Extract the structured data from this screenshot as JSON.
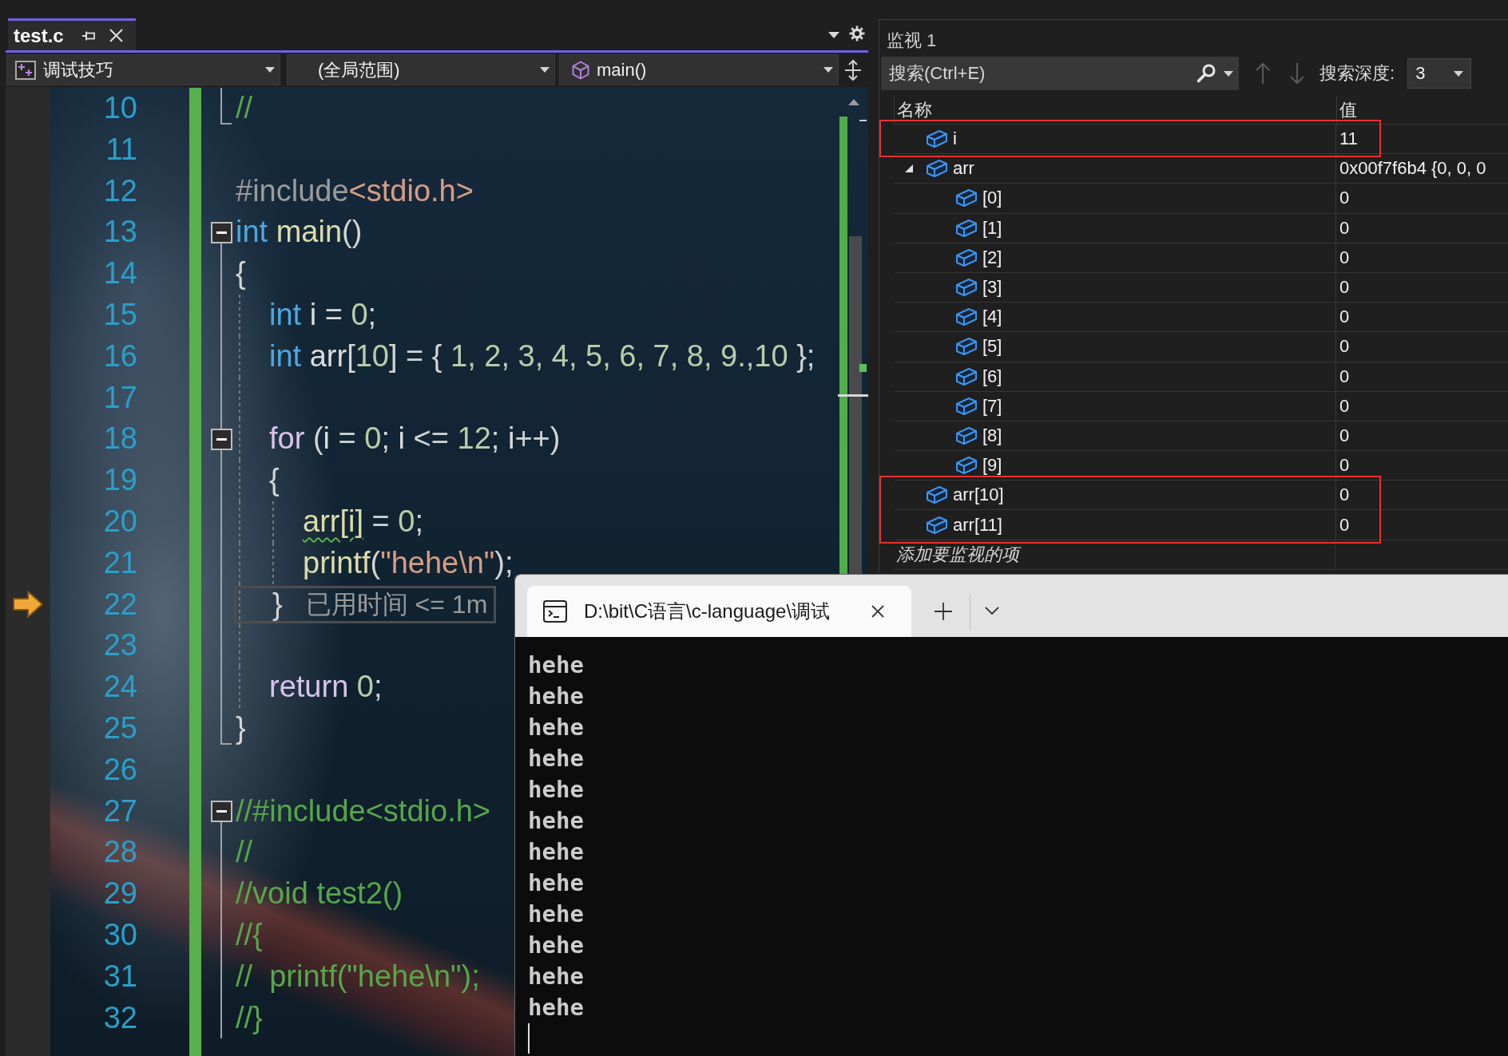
{
  "editor_tabs": [
    {
      "label": "test.c",
      "selected": true
    }
  ],
  "nav_bar": [
    {
      "kind": "project",
      "text": "调试技巧"
    },
    {
      "kind": "scope",
      "text": "(全局范围)"
    },
    {
      "kind": "member",
      "text": "main()"
    }
  ],
  "code_lines": [
    {
      "number": "10",
      "kind": "closer",
      "current": false,
      "tokens": [
        {
          "kind": "comment",
          "text": "//"
        }
      ]
    },
    {
      "number": "11",
      "kind": "plain",
      "current": false
    },
    {
      "number": "12",
      "kind": "plain",
      "current": false,
      "tokens": [
        {
          "kind": "preproc",
          "text": "#include"
        },
        {
          "kind": "string",
          "text": "<stdio.h>"
        }
      ]
    },
    {
      "number": "13",
      "kind": "opener",
      "current": false,
      "tokens": [
        {
          "kind": "keyword",
          "text": "int"
        },
        {
          "kind": "func",
          "text": " main"
        },
        {
          "kind": "punct",
          "text": "()"
        }
      ]
    },
    {
      "number": "14",
      "kind": "inner",
      "current": false,
      "tokens": [
        {
          "kind": "punct",
          "text": "{"
        }
      ],
      "children": [
        {
          "number": "15",
          "kind": "inner",
          "current": false,
          "tokens": [
            {
              "kind": "keyword",
              "text": "int"
            },
            {
              "kind": "ident",
              "text": " i = "
            },
            {
              "kind": "number",
              "text": "0"
            },
            {
              "kind": "punct",
              "text": ";"
            }
          ]
        },
        {
          "number": "16",
          "kind": "inner",
          "current": false,
          "tokens": [
            {
              "kind": "keyword",
              "text": "int"
            },
            {
              "kind": "ident",
              "text": " arr"
            },
            {
              "kind": "punct",
              "text": "["
            },
            {
              "kind": "number",
              "text": "10"
            },
            {
              "kind": "punct",
              "text": "] = { "
            },
            {
              "kind": "number",
              "text": "1, 2, 3, 4, 5, 6, 7, 8, 9.,10"
            },
            {
              "kind": "punct",
              "text": " };"
            }
          ]
        },
        {
          "number": "17",
          "kind": "inner",
          "current": false
        },
        {
          "number": "18",
          "kind": "opener",
          "current": false,
          "tokens": [
            {
              "kind": "control",
              "text": "for"
            },
            {
              "kind": "punct",
              "text": " ("
            },
            {
              "kind": "ident",
              "text": "i"
            },
            {
              "kind": "punct",
              "text": " = "
            },
            {
              "kind": "number",
              "text": "0"
            },
            {
              "kind": "punct",
              "text": "; "
            },
            {
              "kind": "ident",
              "text": "i"
            },
            {
              "kind": "punct",
              "text": " <= "
            },
            {
              "kind": "number",
              "text": "12"
            },
            {
              "kind": "punct",
              "text": "; "
            },
            {
              "kind": "ident",
              "text": "i"
            },
            {
              "kind": "punct",
              "text": "++)"
            }
          ]
        },
        {
          "number": "19",
          "kind": "inner",
          "current": false,
          "tokens": [
            {
              "kind": "punct",
              "text": "{"
            }
          ],
          "children": [
            {
              "number": "20",
              "kind": "inner",
              "current": false,
              "tokens": [
                {
                  "kind": "warning",
                  "text": "arr[i]"
                },
                {
                  "kind": "punct",
                  "text": " = "
                },
                {
                  "kind": "number",
                  "text": "0"
                },
                {
                  "kind": "punct",
                  "text": ";"
                }
              ]
            },
            {
              "number": "21",
              "kind": "inner",
              "current": false,
              "tokens": [
                {
                  "kind": "func",
                  "text": "printf"
                },
                {
                  "kind": "punct",
                  "text": "("
                },
                {
                  "kind": "string",
                  "text": "\"hehe\\n\""
                },
                {
                  "kind": "punct",
                  "text": ");"
                }
              ]
            }
          ]
        },
        {
          "number": "22",
          "kind": "inner",
          "current": true,
          "tokens": [
            {
              "kind": "punct",
              "text": "}"
            }
          ],
          "perf_tip": "已用时间 <= 1m"
        },
        {
          "number": "23",
          "kind": "inner",
          "current": false
        },
        {
          "number": "24",
          "kind": "inner",
          "current": false,
          "tokens": [
            {
              "kind": "control",
              "text": "return"
            },
            {
              "kind": "number",
              "text": " 0"
            },
            {
              "kind": "punct",
              "text": ";"
            }
          ]
        }
      ]
    },
    {
      "number": "25",
      "kind": "closer",
      "current": false,
      "tokens": [
        {
          "kind": "punct",
          "text": "}"
        }
      ]
    },
    {
      "number": "26",
      "kind": "plain",
      "current": false
    },
    {
      "number": "27",
      "kind": "opener",
      "current": false,
      "tokens": [
        {
          "kind": "comment",
          "text": "//#include<stdio.h>"
        }
      ]
    },
    {
      "number": "28",
      "kind": "inner",
      "current": false,
      "tokens": [
        {
          "kind": "comment",
          "text": "//"
        }
      ]
    },
    {
      "number": "29",
      "kind": "inner",
      "current": false,
      "tokens": [
        {
          "kind": "comment",
          "text": "//void test2()"
        }
      ]
    },
    {
      "number": "30",
      "kind": "inner",
      "current": false,
      "tokens": [
        {
          "kind": "comment",
          "text": "//{"
        }
      ]
    },
    {
      "number": "31",
      "kind": "inner",
      "current": false,
      "tokens": [
        {
          "kind": "comment",
          "text": "//  printf(\"hehe\\n\");"
        }
      ]
    },
    {
      "number": "32",
      "kind": "inner",
      "current": false,
      "tokens": [
        {
          "kind": "comment",
          "text": "//}"
        }
      ]
    }
  ],
  "watch": {
    "title": "监视 1",
    "search": {
      "placeholder": "搜索(Ctrl+E)"
    },
    "search_nav": [
      {
        "kind": "up",
        "disabled": true
      },
      {
        "kind": "down",
        "disabled": true
      }
    ],
    "depth": {
      "label": "搜索深度:",
      "value": "3"
    },
    "columns": [
      "名称",
      "值"
    ],
    "rows": [
      {
        "name": "i",
        "value": "11",
        "highlighted": true
      },
      {
        "name": "arr",
        "value": "0x00f7f6b4 {0, 0, 0",
        "expanded": true,
        "highlighted": false,
        "children": [
          {
            "name": "[0]",
            "value": "0",
            "highlighted": false
          },
          {
            "name": "[1]",
            "value": "0",
            "highlighted": false
          },
          {
            "name": "[2]",
            "value": "0",
            "highlighted": false
          },
          {
            "name": "[3]",
            "value": "0",
            "highlighted": false
          },
          {
            "name": "[4]",
            "value": "0",
            "highlighted": false
          },
          {
            "name": "[5]",
            "value": "0",
            "highlighted": false
          },
          {
            "name": "[6]",
            "value": "0",
            "highlighted": false
          },
          {
            "name": "[7]",
            "value": "0",
            "highlighted": false
          },
          {
            "name": "[8]",
            "value": "0",
            "highlighted": false
          },
          {
            "name": "[9]",
            "value": "0",
            "highlighted": false
          }
        ]
      },
      {
        "name": "arr[10]",
        "value": "0",
        "highlighted": true
      },
      {
        "name": "arr[11]",
        "value": "0",
        "highlighted": true
      }
    ],
    "add_item": {
      "placeholder": "添加要监视的项"
    }
  },
  "console": {
    "tabs": [
      {
        "title": "D:\\bit\\C语言\\c-language\\调试",
        "selected": true
      }
    ],
    "output": [
      "hehe",
      "hehe",
      "hehe",
      "hehe",
      "hehe",
      "hehe",
      "hehe",
      "hehe",
      "hehe",
      "hehe",
      "hehe",
      "hehe"
    ]
  }
}
